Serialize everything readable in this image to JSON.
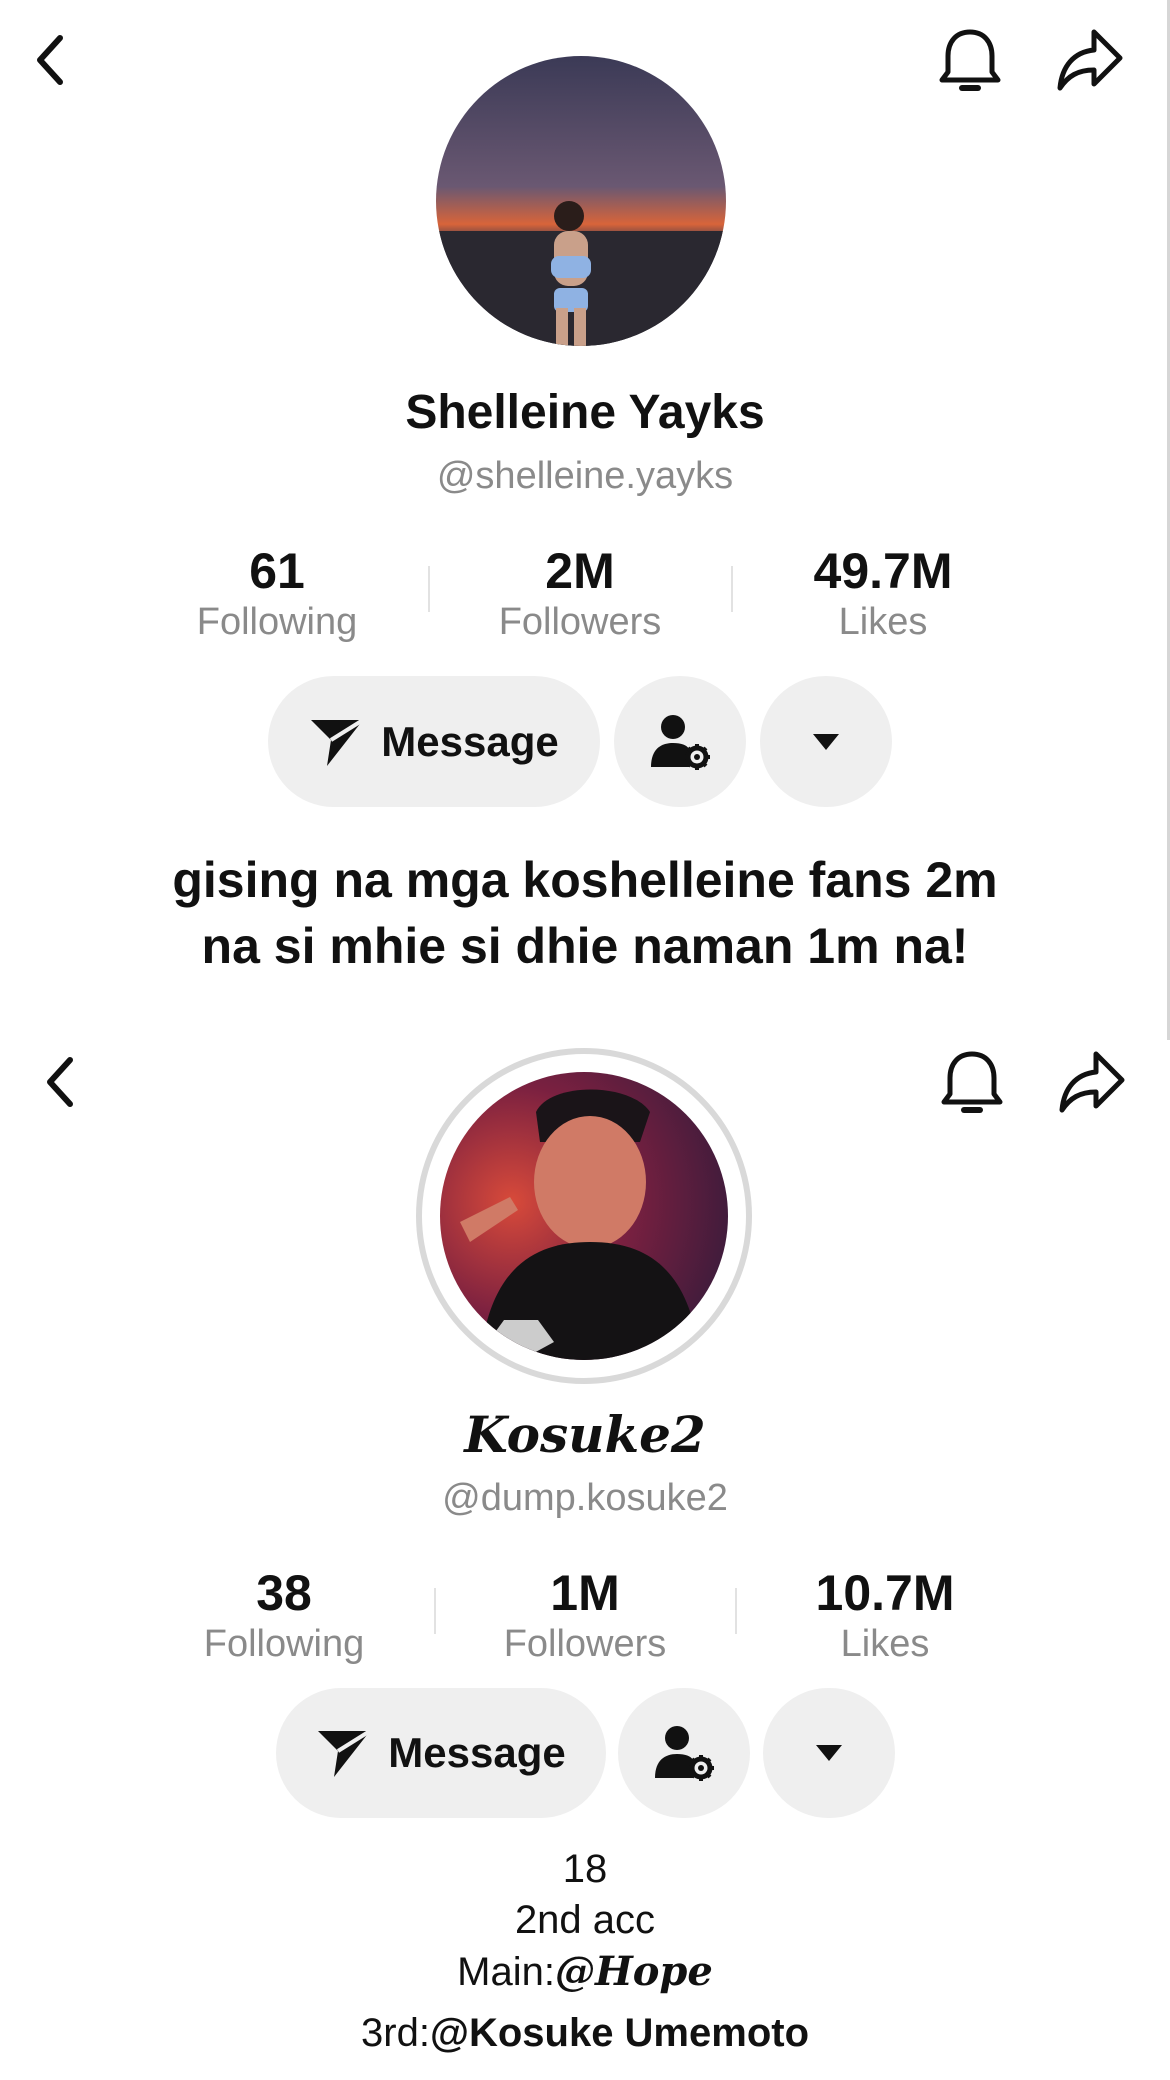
{
  "profiles": [
    {
      "display_name": "Shelleine Yayks",
      "username": "@shelleine.yayks",
      "stats": [
        {
          "value": "61",
          "label": "Following"
        },
        {
          "value": "2M",
          "label": "Followers"
        },
        {
          "value": "49.7M",
          "label": "Likes"
        }
      ],
      "message_label": "Message",
      "bio_lines": [
        "gising na mga koshelleine fans 2m",
        "na si mhie si dhie naman 1m na!"
      ]
    },
    {
      "display_name": "Kosuke2",
      "username": "@dump.kosuke2",
      "stats": [
        {
          "value": "38",
          "label": "Following"
        },
        {
          "value": "1M",
          "label": "Followers"
        },
        {
          "value": "10.7M",
          "label": "Likes"
        }
      ],
      "message_label": "Message",
      "bio": {
        "line1": "18",
        "line2": "2nd acc",
        "line3_prefix": "Main:",
        "line3_handle": "@Hope",
        "line4_prefix": "3rd:",
        "line4_handle": "@Kosuke Umemoto"
      }
    }
  ],
  "icons": {
    "back": "chevron-left-icon",
    "notifications": "bell-icon",
    "share": "share-arrow-icon",
    "message": "paper-plane-icon",
    "friend_settings": "person-gear-icon",
    "more": "caret-down-icon"
  },
  "colors": {
    "button_bg": "#efefef",
    "secondary_text": "#8a8a8a",
    "ring": "#d9d9d9"
  }
}
